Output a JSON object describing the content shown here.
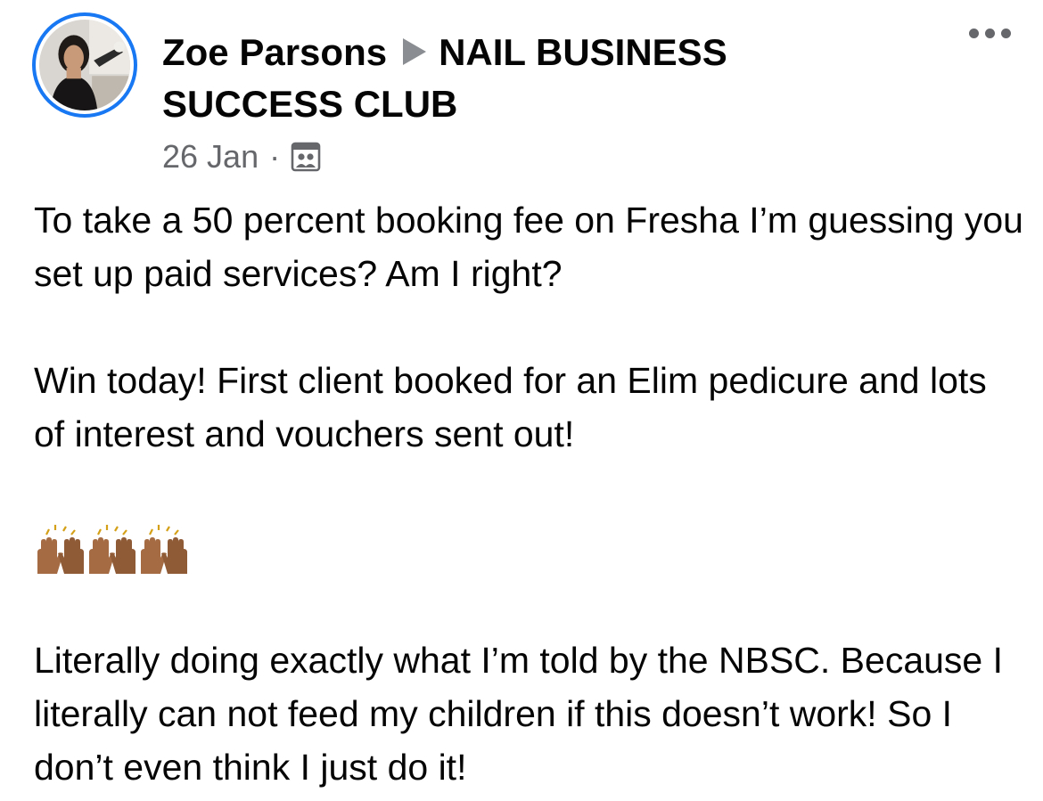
{
  "post": {
    "author": "Zoe Parsons",
    "group": "NAIL BUSINESS SUCCESS CLUB",
    "date": "26 Jan",
    "separator": "·",
    "audience_icon": "group-audience-icon",
    "more_icon": "more-options-icon",
    "paragraphs": [
      "To take a 50 percent booking fee on Fresha I’m guessing you set up paid services? Am I right?",
      "Win today! First client booked for an Elim pedicure and lots of interest and vouchers sent out!",
      "Literally doing exactly what I’m told by the NBSC. Because I literally can not feed my children if this doesn’t work! So I don’t even think I just do it!"
    ],
    "emoji": [
      "raising-hands-icon",
      "raising-hands-icon",
      "raising-hands-icon"
    ]
  },
  "colors": {
    "accent": "#1877f2",
    "text": "#050505",
    "secondary_text": "#65676b",
    "arrow": "#8a8d91",
    "skin": "#a56c43"
  }
}
